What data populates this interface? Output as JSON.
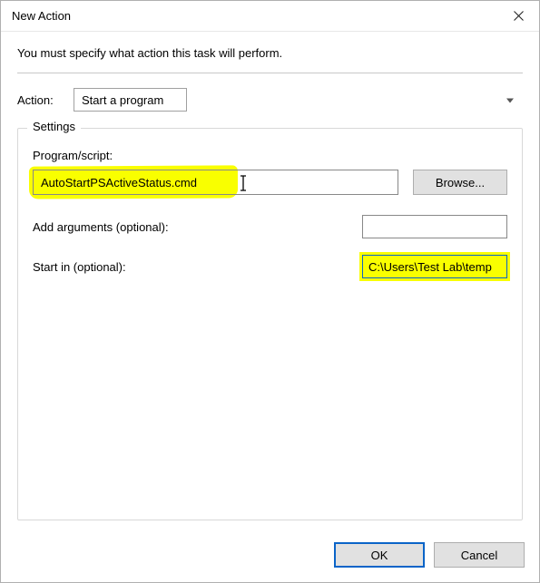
{
  "window": {
    "title": "New Action"
  },
  "instruction": "You must specify what action this task will perform.",
  "action": {
    "label": "Action:",
    "selected": "Start a program"
  },
  "settings": {
    "legend": "Settings",
    "program": {
      "label": "Program/script:",
      "value": "AutoStartPSActiveStatus.cmd",
      "browse": "Browse..."
    },
    "arguments": {
      "label": "Add arguments (optional):",
      "value": ""
    },
    "startin": {
      "label": "Start in (optional):",
      "value": "C:\\Users\\Test Lab\\temp"
    }
  },
  "buttons": {
    "ok": "OK",
    "cancel": "Cancel"
  }
}
